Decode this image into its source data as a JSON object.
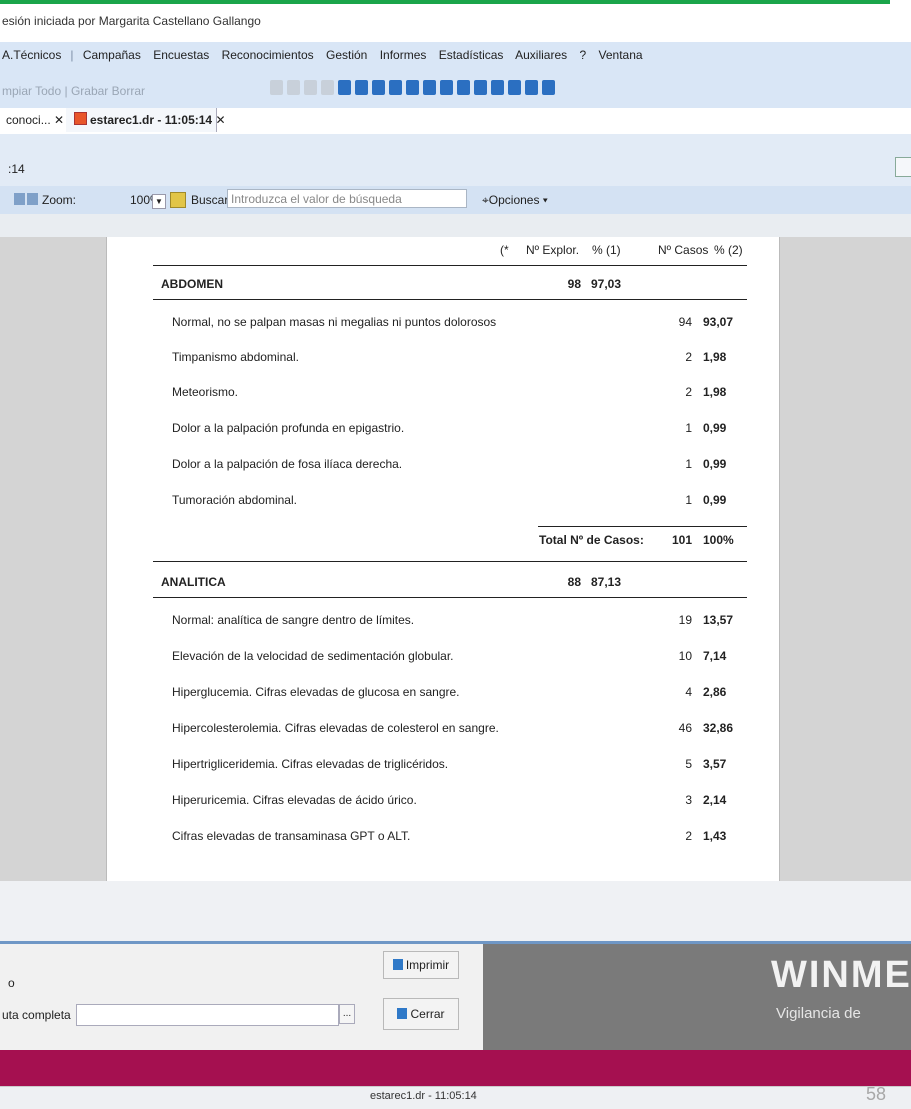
{
  "session_text": "esión iniciada por Margarita Castellano Gallango",
  "menu": [
    "A.Técnicos",
    "Campañas",
    "Encuestas",
    "Reconocimientos",
    "Gestión",
    "Informes",
    "Estadísticas",
    "Auxiliares",
    "?",
    "Ventana"
  ],
  "toolbar": {
    "clear_label": "mpiar Todo",
    "save_label": "Grabar",
    "delete_label": "Borrar"
  },
  "tabs": [
    {
      "label": "conoci..."
    },
    {
      "label": "estarec1.dr - 11:05:14"
    }
  ],
  "viewer": {
    "title": ":14",
    "zoom_label": "Zoom:",
    "zoom_value": "100%",
    "find_label": "Buscar:",
    "find_placeholder": "Introduzca el valor de búsqueda",
    "options_label": "Opciones"
  },
  "report": {
    "columns": [
      "(*",
      "Nº Explor.",
      "% (1)",
      "Nº Casos",
      "% (2)"
    ],
    "sections": [
      {
        "title": "ABDOMEN",
        "explor": "98",
        "pct": "97,03",
        "rows": [
          {
            "label": "Normal, no se palpan masas ni megalias ni puntos dolorosos",
            "cases": "94",
            "pct": "93,07"
          },
          {
            "label": "Timpanismo abdominal.",
            "cases": "2",
            "pct": "1,98"
          },
          {
            "label": "Meteorismo.",
            "cases": "2",
            "pct": "1,98"
          },
          {
            "label": "Dolor a la palpación profunda en epigastrio.",
            "cases": "1",
            "pct": "0,99"
          },
          {
            "label": "Dolor a la palpación de fosa ilíaca derecha.",
            "cases": "1",
            "pct": "0,99"
          },
          {
            "label": "Tumoración abdominal.",
            "cases": "1",
            "pct": "0,99"
          }
        ],
        "total_label": "Total Nº de Casos:",
        "total_cases": "101",
        "total_pct": "100%"
      },
      {
        "title": "ANALITICA",
        "explor": "88",
        "pct": "87,13",
        "rows": [
          {
            "label": "Normal: analítica de sangre dentro de límites.",
            "cases": "19",
            "pct": "13,57"
          },
          {
            "label": "Elevación de la velocidad de sedimentación globular.",
            "cases": "10",
            "pct": "7,14"
          },
          {
            "label": "Hiperglucemia. Cifras elevadas de glucosa en sangre.",
            "cases": "4",
            "pct": "2,86"
          },
          {
            "label": "Hipercolesterolemia. Cifras elevadas de colesterol en sangre.",
            "cases": "46",
            "pct": "32,86"
          },
          {
            "label": "Hipertrigliceridemia. Cifras elevadas de triglicéridos.",
            "cases": "5",
            "pct": "3,57"
          },
          {
            "label": "Hiperuricemia. Cifras elevadas de ácido úrico.",
            "cases": "3",
            "pct": "2,14"
          },
          {
            "label": "Cifras elevadas de transaminasa GPT o ALT.",
            "cases": "2",
            "pct": "1,43"
          }
        ]
      }
    ]
  },
  "dialog": {
    "label_top": "o",
    "label_path": "uta completa",
    "print_label": "Imprimir",
    "close_label": "Cerrar"
  },
  "watermark": {
    "big": "WINME",
    "small": "Vigilancia de"
  },
  "status": {
    "tab_label": "estarec1.dr - 11:05:14"
  },
  "page_number": "58"
}
